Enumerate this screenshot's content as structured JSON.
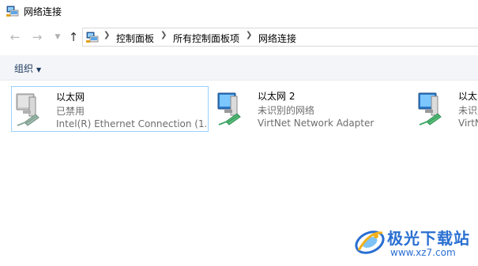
{
  "window": {
    "title": "网络连接"
  },
  "address": {
    "breadcrumbs": [
      "控制面板",
      "所有控制面板项",
      "网络连接"
    ]
  },
  "toolbar": {
    "organize_label": "组织"
  },
  "connections": [
    {
      "name": "以太网",
      "status": "已禁用",
      "device": "Intel(R) Ethernet Connection (1...",
      "selected": true
    },
    {
      "name": "以太网 2",
      "status": "未识别的网络",
      "device": "VirtNet Network Adapter",
      "selected": false
    },
    {
      "name": "以太网",
      "status": "未识别",
      "device": "VirtNet",
      "selected": false
    }
  ],
  "watermark": {
    "cn": "极光下载站",
    "url": "www.xz7.com"
  },
  "colors": {
    "selection_border": "#99d1ff",
    "toolbar_bg": "#f3f5f9",
    "watermark_blue": "#2a6fd1"
  }
}
